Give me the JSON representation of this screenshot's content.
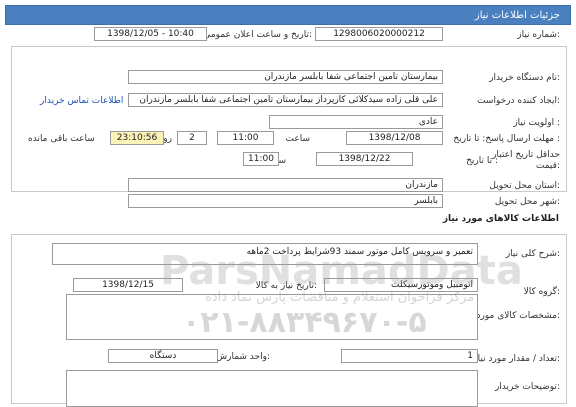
{
  "header": {
    "title": "جزئیات اطلاعات نیاز"
  },
  "need_info": {
    "need_number": {
      "label": "شماره نیاز:",
      "value": "1298006020000212"
    },
    "announce_datetime": {
      "label": "تاریخ و ساعت اعلان عمومی:",
      "value": "1398/12/05 - 10:40"
    },
    "buyer_org": {
      "label": "نام دستگاه خریدار:",
      "value": "بیمارستان تامین اجتماعی شفا بابلسر مازندران"
    },
    "requester": {
      "label": "ایجاد کننده درخواست:",
      "value": "علی قلی زاده سیدکلائی کارپرداز بیمارستان تامین اجتماعی شفا بابلسر مازندران",
      "contact_link": "اطلاعات تماس خریدار"
    },
    "priority": {
      "label": "اولویت نیاز :",
      "value": "عادی"
    },
    "reply_deadline": {
      "label": "مهلت ارسال پاسخ: تا تاریخ :",
      "date": "1398/12/08",
      "time_label": "ساعت",
      "time": "11:00",
      "days": "2",
      "days_label": "روز و",
      "remaining": "23:10:56",
      "remaining_label": "ساعت باقی مانده"
    },
    "price_validity": {
      "label1": "حداقل تاریخ اعتبار",
      "label2": "قیمت:",
      "to_date_label": "تا تاریخ :",
      "date": "1398/12/22",
      "time_label": "ساعت",
      "time": "11:00"
    },
    "delivery_province": {
      "label": "استان محل تحویل:",
      "value": "مازندران"
    },
    "delivery_city": {
      "label": "شهر محل تحویل:",
      "value": "بابلسر"
    }
  },
  "goods_section": {
    "title": "اطلاعات کالاهای مورد نیاز",
    "general_desc": {
      "label": "شرح کلی نیاز:",
      "value": "تعمیر و سرویس کامل موتور سمند 93شرایط پرداخت 2ماهه"
    },
    "goods_group": {
      "label": "گروه کالا:",
      "value": "اتومبیل وموتورسیکلت"
    },
    "need_date": {
      "label": "تاریخ نیاز به کالا:",
      "value": "1398/12/15"
    },
    "needed_specs": {
      "label": "مشخصات کالای مورد نیاز:",
      "value": ""
    },
    "quantity": {
      "label": "تعداد / مقدار مورد نیاز:",
      "value": "1"
    },
    "unit": {
      "label": "واحد شمارش:",
      "value": "دستگاه"
    },
    "buyer_notes": {
      "label": "توضیحات خریدار:",
      "value": ""
    }
  },
  "watermark": {
    "brand": "ParsNamadData",
    "phone": "۰۲۱-۸۸۳۴۹۶۷۰-۵",
    "caption": "مرکز فراخوان استعلام و مناقصات پارس نماد داده"
  },
  "colors": {
    "titlebar": "#4a7fc0",
    "highlight": "#fbf3b8",
    "link": "#1a4fb5"
  }
}
